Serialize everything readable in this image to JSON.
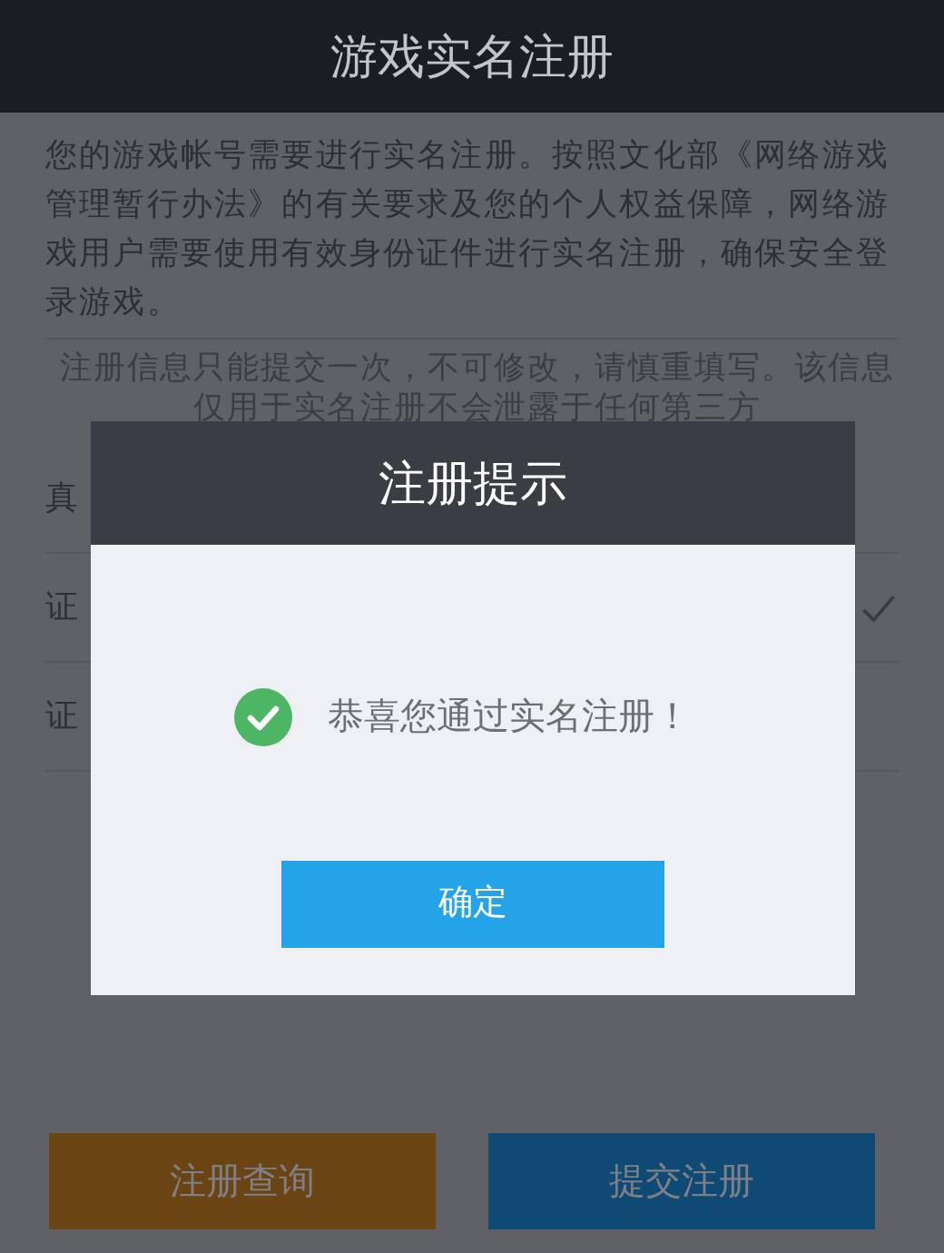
{
  "header": {
    "title": "游戏实名注册"
  },
  "intro": "您的游戏帐号需要进行实名注册。按照文化部《网络游戏管理暂行办法》的有关要求及您的个人权益保障，网络游戏用户需要使用有效身份证件进行实名注册，确保安全登录游戏。",
  "notice": "注册信息只能提交一次，不可修改，请慎重填写。该信息仅用于实名注册不会泄露于任何第三方",
  "form": {
    "rows": [
      {
        "label": "真",
        "checked": false
      },
      {
        "label": "证",
        "checked": true
      },
      {
        "label": "证",
        "checked": false
      }
    ]
  },
  "dialog": {
    "title": "注册提示",
    "message": "恭喜您通过实名注册！",
    "button": "确定"
  },
  "buttons": [
    {
      "label": "注册查询",
      "kind": "query"
    },
    {
      "label": "提交注册",
      "kind": "submit"
    }
  ]
}
